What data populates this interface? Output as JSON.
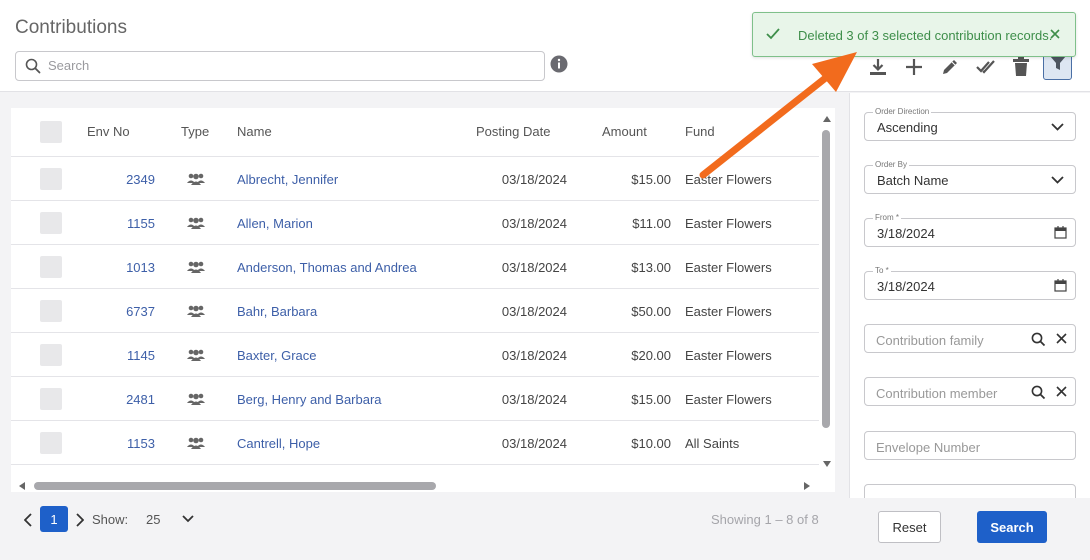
{
  "header": {
    "title": "Contributions",
    "search_placeholder": "Search"
  },
  "toast": {
    "message": "Deleted 3 of 3 selected contribution records."
  },
  "toolbar": {
    "icons": [
      "download-icon",
      "plus-icon",
      "pencil-icon",
      "double-check-icon",
      "trash-icon",
      "filter-icon"
    ]
  },
  "grid": {
    "columns": [
      "Env No",
      "Type",
      "Name",
      "Posting Date",
      "Amount",
      "Fund"
    ],
    "rows": [
      {
        "env_no": "2349",
        "name": "Albrecht, Jennifer",
        "posting_date": "03/18/2024",
        "amount": "$15.00",
        "fund": "Easter Flowers"
      },
      {
        "env_no": "1155",
        "name": "Allen, Marion",
        "posting_date": "03/18/2024",
        "amount": "$11.00",
        "fund": "Easter Flowers"
      },
      {
        "env_no": "1013",
        "name": "Anderson, Thomas and Andrea",
        "posting_date": "03/18/2024",
        "amount": "$13.00",
        "fund": "Easter Flowers"
      },
      {
        "env_no": "6737",
        "name": "Bahr, Barbara",
        "posting_date": "03/18/2024",
        "amount": "$50.00",
        "fund": "Easter Flowers"
      },
      {
        "env_no": "1145",
        "name": "Baxter, Grace",
        "posting_date": "03/18/2024",
        "amount": "$20.00",
        "fund": "Easter Flowers"
      },
      {
        "env_no": "2481",
        "name": "Berg, Henry and Barbara",
        "posting_date": "03/18/2024",
        "amount": "$15.00",
        "fund": "Easter Flowers"
      },
      {
        "env_no": "1153",
        "name": "Cantrell, Hope",
        "posting_date": "03/18/2024",
        "amount": "$10.00",
        "fund": "All Saints"
      }
    ]
  },
  "pager": {
    "current_page": "1",
    "show_label": "Show:",
    "page_size": "25",
    "showing_text": "Showing 1 – 8 of 8"
  },
  "filters": {
    "order_direction": {
      "label": "Order Direction",
      "value": "Ascending"
    },
    "order_by": {
      "label": "Order By",
      "value": "Batch Name"
    },
    "from": {
      "label": "From *",
      "value": "3/18/2024"
    },
    "to": {
      "label": "To *",
      "value": "3/18/2024"
    },
    "contribution_family": {
      "placeholder": "Contribution family"
    },
    "contribution_member": {
      "placeholder": "Contribution member"
    },
    "envelope_number": {
      "placeholder": "Envelope Number"
    },
    "reset_label": "Reset",
    "search_label": "Search"
  },
  "colors": {
    "primary": "#1e60c9",
    "link": "#3d5fa8",
    "toast_bg": "#e8f5e9",
    "toast_text": "#3e8e4a",
    "annotation_arrow": "#f26b1d"
  }
}
